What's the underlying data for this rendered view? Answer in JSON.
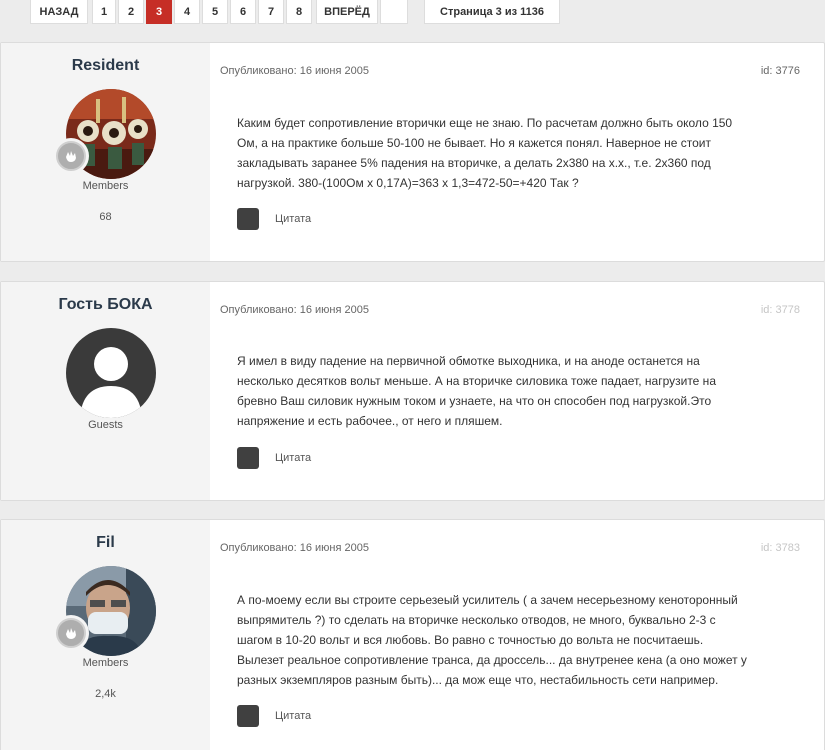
{
  "pagination": {
    "prev": "НАЗАД",
    "pages": [
      "1",
      "2",
      "3",
      "4",
      "5",
      "6",
      "7",
      "8"
    ],
    "active_page": "3",
    "next": "ВПЕРЁД",
    "page_info": "Страница 3 из 1136"
  },
  "posts": [
    {
      "author": "Resident",
      "group": "Members",
      "post_count": "68",
      "published": "Опубликовано: 16 июня 2005",
      "id": "id: 3776",
      "lines": [
        "Каким будет сопротивление вторички еще не знаю. По расчетам должно быть около 150",
        "Ом, а на практике больше 50-100 не бывает.  Но я кажется понял. Наверное не стоит",
        "закладывать заранее 5% падения на вторичке, а делать 2х380 на х.х., т.е. 2х360 под",
        "нагрузкой. 380-(100Ом х 0,17А)=363 х 1,3=472-50=+420 Так ?"
      ],
      "quote": "Цитата"
    },
    {
      "author": "Гость БОКА",
      "group": "Guests",
      "published": "Опубликовано: 16 июня 2005",
      "id": "id: 3778",
      "lines": [
        "Я имел в виду падение на первичной обмотке выходника, и на аноде останется на",
        "несколько десятков вольт меньше. А на вторичке силовика тоже падает, нагрузите на",
        "бревно Ваш силовик нужным током и узнаете, на что он способен под нагрузкой.Это",
        "напряжение и есть рабочее., от него и пляшем."
      ],
      "quote": "Цитата"
    },
    {
      "author": "Fil",
      "group": "Members",
      "post_count": "2,4k",
      "published": "Опубликовано: 16 июня 2005",
      "id": "id: 3783",
      "lines": [
        "А по-моему если вы строите серьезеый усилитель ( а зачем несерьезному кеноторонный",
        "выпрямитель ?) то сделать на вторичке несколько отводов, не много, буквально 2-3 с",
        "шагом в 10-20 вольт и вся любовь. Во равно с точностью до вольта не посчитаешь.",
        "Вылезет реальное сопротивление транса, да дроссель... да внутренее кена (а оно может у",
        "разных экземпляров разным быть)... да мож еще что, нестабильность сети например."
      ],
      "quote": "Цитата"
    }
  ],
  "icons": {
    "badge": "hand-badge-icon",
    "quote": "quote-icon",
    "guest_avatar": "default-user-icon"
  },
  "colors": {
    "active_page": "#c62e26",
    "author_name": "#2b3a4a"
  }
}
